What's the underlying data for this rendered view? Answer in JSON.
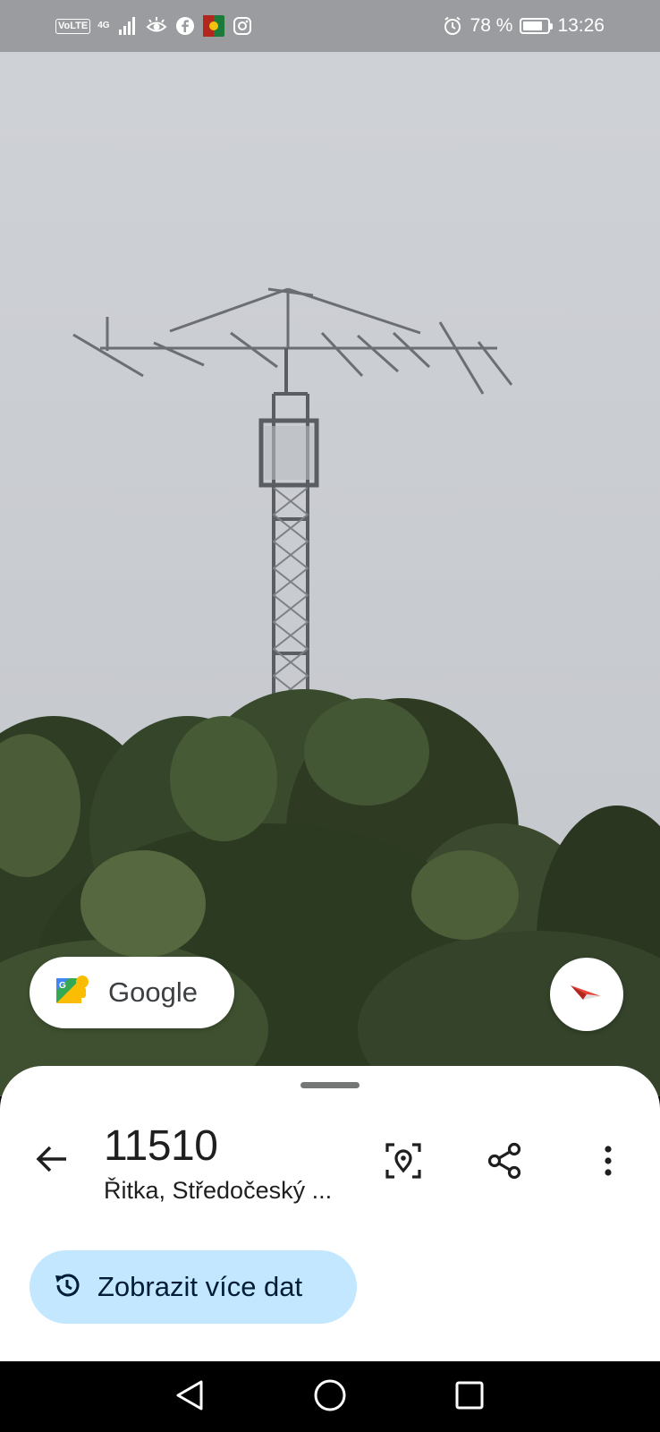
{
  "status_bar": {
    "volte": "VoLTE",
    "network": "4G",
    "battery_text": "78 %",
    "battery_level": 0.78,
    "time": "13:26",
    "icons": [
      "volte-icon",
      "signal-icon",
      "eye-comfort-icon",
      "facebook-icon",
      "app-icon",
      "instagram-icon",
      "alarm-icon",
      "battery-icon"
    ]
  },
  "photo": {
    "subject": "antenna-tower-image"
  },
  "google_chip": {
    "label": "Google",
    "icon": "street-view-icon"
  },
  "compass": {
    "icon": "compass-icon",
    "accent": "#ea4335"
  },
  "place": {
    "title": "11510",
    "subtitle": "Řitka, Středočeský ..."
  },
  "actions": {
    "back_icon": "arrow-back-icon",
    "pin_icon": "location-pin-icon",
    "share_icon": "share-icon",
    "more_icon": "more-vert-icon"
  },
  "more_data": {
    "label": "Zobrazit více dat",
    "icon": "history-icon",
    "bg": "#c2e7ff"
  },
  "nav_bar": {
    "back_icon": "nav-back-icon",
    "home_icon": "nav-home-icon",
    "recents_icon": "nav-recents-icon"
  }
}
